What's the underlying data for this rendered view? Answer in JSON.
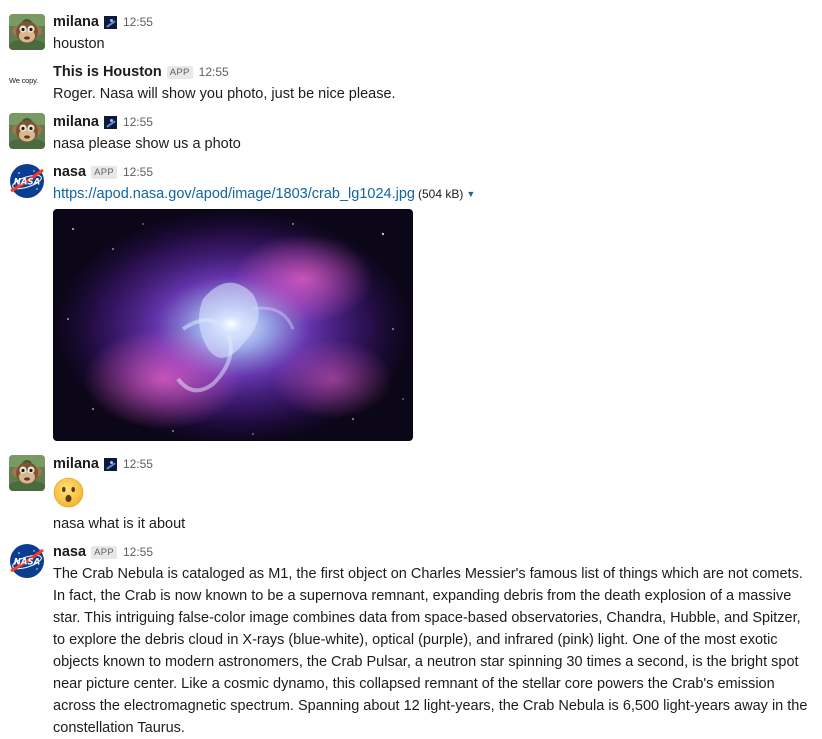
{
  "messages": [
    {
      "author": "milana",
      "avatar_icon": "monkey-avatar-icon",
      "time": "12:55",
      "text": "houston"
    },
    {
      "author": "This is Houston",
      "app_tag": "APP",
      "avatar_text": "We copy.",
      "time": "12:55",
      "text": "Roger. Nasa will show you photo, just be nice please."
    },
    {
      "author": "milana",
      "avatar_icon": "monkey-avatar-icon",
      "time": "12:55",
      "text": "nasa please show us a photo"
    },
    {
      "author": "nasa",
      "app_tag": "APP",
      "avatar_icon": "nasa-logo-icon",
      "time": "12:55",
      "link": "https://apod.nasa.gov/apod/image/1803/crab_lg1024.jpg",
      "file_size": "(504 kB)",
      "image_icon": "crab-nebula-image"
    },
    {
      "author": "milana",
      "avatar_icon": "monkey-avatar-icon",
      "time": "12:55",
      "emoji": "hushed-face-emoji",
      "text": "nasa what is it about"
    },
    {
      "author": "nasa",
      "app_tag": "APP",
      "avatar_icon": "nasa-logo-icon",
      "time": "12:55",
      "text": "The Crab Nebula is cataloged as M1, the first object on Charles Messier's famous list of things which are not comets. In fact, the Crab is now known to be a supernova remnant, expanding debris from the death explosion of a massive star. This intriguing false-color image combines data from space-based observatories, Chandra, Hubble, and Spitzer, to explore the debris cloud in X-rays (blue-white), optical (purple), and infrared (pink) light. One of the most exotic objects known to modern astronomers, the Crab Pulsar, a neutron star spinning 30 times a second, is the bright spot near picture center. Like a cosmic dynamo, this collapsed remnant of the stellar core powers the Crab's emission across the electromagnetic spectrum. Spanning about 12 light-years, the Crab Nebula is 6,500 light-years away in the constellation Taurus."
    }
  ],
  "colors": {
    "link": "#1264a3",
    "text": "#1d1c1d",
    "meta": "#616061"
  }
}
